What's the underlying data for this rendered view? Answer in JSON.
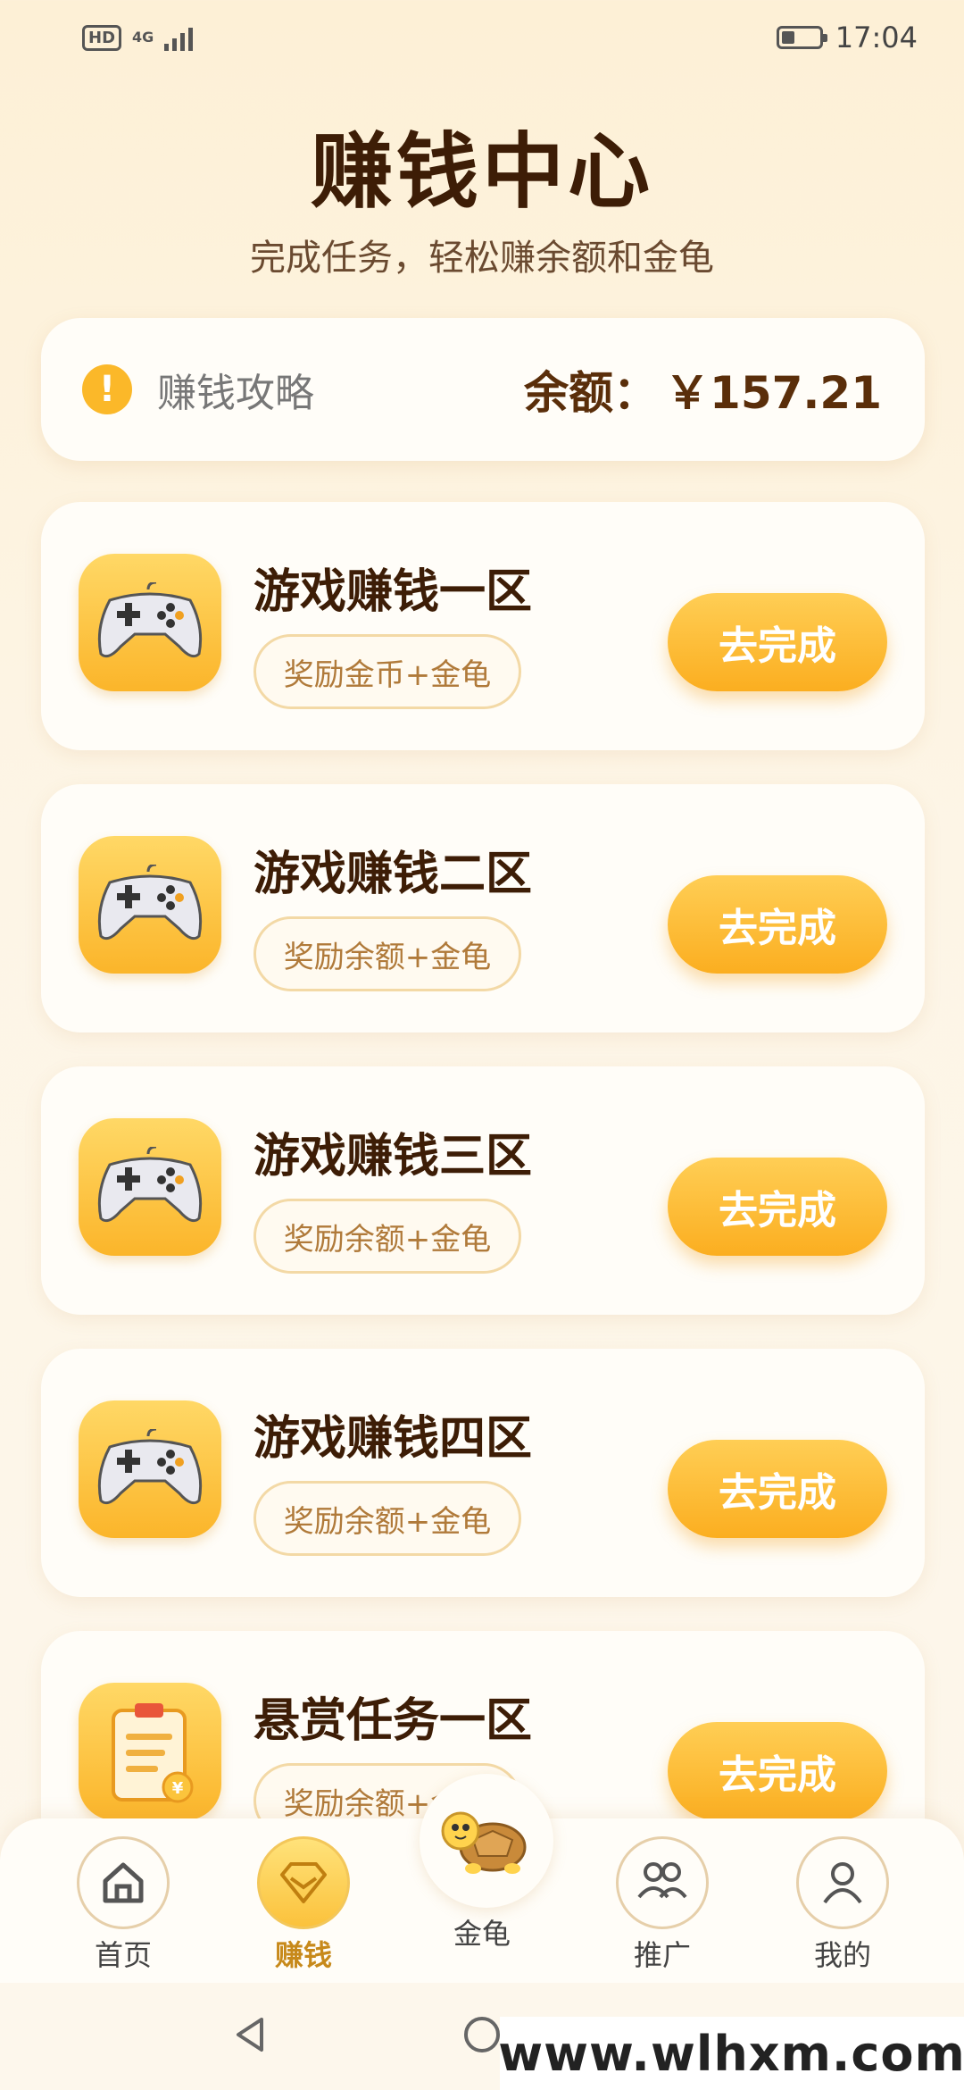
{
  "status_bar": {
    "network_badge": "HD",
    "network_type": "4G",
    "time": "17:04"
  },
  "header": {
    "title": "赚钱中心",
    "subtitle": "完成任务，轻松赚余额和金龟"
  },
  "balance_card": {
    "guide_icon": "exclamation-icon",
    "guide_label": "赚钱攻略",
    "balance_label": "余额：",
    "balance_amount": "￥157.21"
  },
  "tasks": [
    {
      "title": "游戏赚钱一区",
      "reward": "奖励金币+金龟",
      "button": "去完成",
      "icon": "gamepad-icon"
    },
    {
      "title": "游戏赚钱二区",
      "reward": "奖励余额+金龟",
      "button": "去完成",
      "icon": "gamepad-icon"
    },
    {
      "title": "游戏赚钱三区",
      "reward": "奖励余额+金龟",
      "button": "去完成",
      "icon": "gamepad-icon"
    },
    {
      "title": "游戏赚钱四区",
      "reward": "奖励余额+金龟",
      "button": "去完成",
      "icon": "gamepad-icon"
    },
    {
      "title": "悬赏任务一区",
      "reward": "奖励余额+金龟",
      "button": "去完成",
      "icon": "clipboard-icon"
    }
  ],
  "tab_bar": {
    "items": [
      {
        "label": "首页",
        "icon": "home-icon"
      },
      {
        "label": "赚钱",
        "icon": "diamond-icon",
        "active": true
      },
      {
        "label": "金龟",
        "icon": "turtle-icon"
      },
      {
        "label": "推广",
        "icon": "people-icon"
      },
      {
        "label": "我的",
        "icon": "user-icon"
      }
    ]
  },
  "watermark": "www.wlhxm.com",
  "colors": {
    "accent": "#fbb52a",
    "title_brown": "#3d1d06",
    "background": "#fdf0d6"
  }
}
